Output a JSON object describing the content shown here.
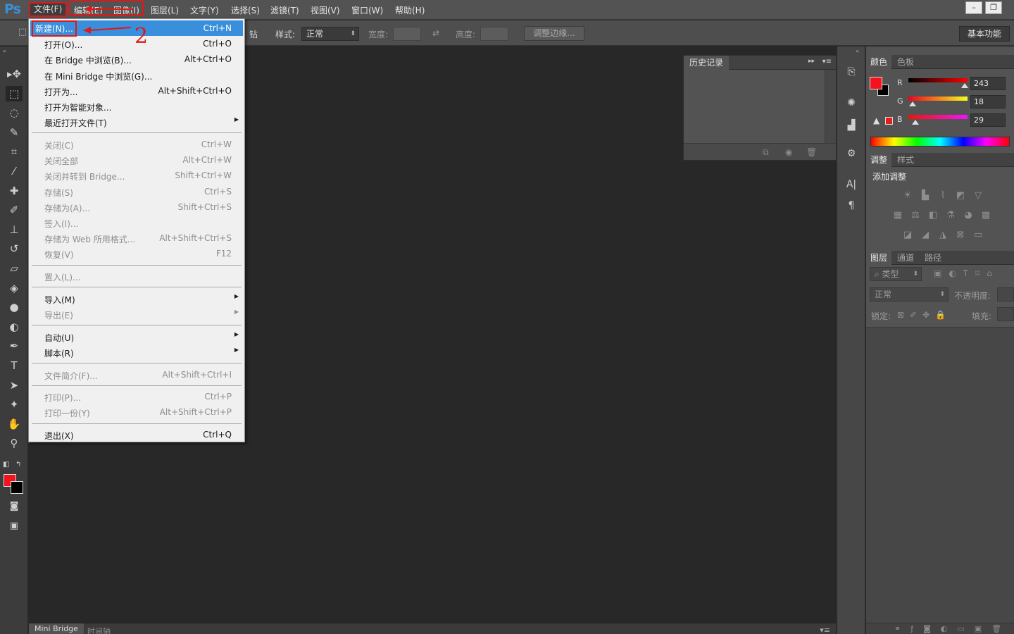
{
  "app": {
    "logo": "Ps"
  },
  "menubar": {
    "items": [
      "文件(F)",
      "编辑(E)",
      "图像(I)",
      "图层(L)",
      "文字(Y)",
      "选择(S)",
      "滤镜(T)",
      "视图(V)",
      "窗口(W)",
      "帮助(H)"
    ],
    "window_buttons": [
      "–",
      "❐"
    ]
  },
  "options_bar": {
    "clipped_label": "钻",
    "style_label": "样式:",
    "style_value": "正常",
    "width_label": "宽度:",
    "swap_icon": "⇄",
    "height_label": "高度:",
    "refine_edge": "调整边缘...",
    "workspace": "基本功能"
  },
  "annotation": {
    "step_number": "2"
  },
  "file_menu": {
    "items": [
      {
        "label": "新建(N)...",
        "shortcut": "Ctrl+N",
        "state": "highlighted"
      },
      {
        "label": "打开(O)...",
        "shortcut": "Ctrl+O"
      },
      {
        "label": "在 Bridge 中浏览(B)...",
        "shortcut": "Alt+Ctrl+O"
      },
      {
        "label": "在 Mini Bridge 中浏览(G)...",
        "shortcut": ""
      },
      {
        "label": "打开为...",
        "shortcut": "Alt+Shift+Ctrl+O"
      },
      {
        "label": "打开为智能对象...",
        "shortcut": ""
      },
      {
        "label": "最近打开文件(T)",
        "shortcut": "",
        "submenu": true
      },
      {
        "label": "关闭(C)",
        "shortcut": "Ctrl+W",
        "state": "disabled"
      },
      {
        "label": "关闭全部",
        "shortcut": "Alt+Ctrl+W",
        "state": "disabled"
      },
      {
        "label": "关闭并转到 Bridge...",
        "shortcut": "Shift+Ctrl+W",
        "state": "disabled"
      },
      {
        "label": "存储(S)",
        "shortcut": "Ctrl+S",
        "state": "disabled"
      },
      {
        "label": "存储为(A)...",
        "shortcut": "Shift+Ctrl+S",
        "state": "disabled"
      },
      {
        "label": "签入(I)...",
        "shortcut": "",
        "state": "disabled"
      },
      {
        "label": "存储为 Web 所用格式...",
        "shortcut": "Alt+Shift+Ctrl+S",
        "state": "disabled"
      },
      {
        "label": "恢复(V)",
        "shortcut": "F12",
        "state": "disabled"
      },
      {
        "label": "置入(L)...",
        "shortcut": "",
        "state": "disabled"
      },
      {
        "label": "导入(M)",
        "shortcut": "",
        "submenu": true
      },
      {
        "label": "导出(E)",
        "shortcut": "",
        "submenu": true,
        "state": "disabled"
      },
      {
        "label": "自动(U)",
        "shortcut": "",
        "submenu": true
      },
      {
        "label": "脚本(R)",
        "shortcut": "",
        "submenu": true
      },
      {
        "label": "文件简介(F)...",
        "shortcut": "Alt+Shift+Ctrl+I",
        "state": "disabled"
      },
      {
        "label": "打印(P)...",
        "shortcut": "Ctrl+P",
        "state": "disabled"
      },
      {
        "label": "打印一份(Y)",
        "shortcut": "Alt+Shift+Ctrl+P",
        "state": "disabled"
      },
      {
        "label": "退出(X)",
        "shortcut": "Ctrl+Q"
      }
    ],
    "submenu_glyph": "▶"
  },
  "toolbar": {
    "tools": [
      {
        "name": "move-tool",
        "glyph": "▸✥"
      },
      {
        "name": "marquee-tool",
        "glyph": "⬚",
        "selected": true
      },
      {
        "name": "lasso-tool",
        "glyph": "◌"
      },
      {
        "name": "quick-selection-tool",
        "glyph": "✎"
      },
      {
        "name": "crop-tool",
        "glyph": "⌗"
      },
      {
        "name": "eyedropper-tool",
        "glyph": "⁄"
      },
      {
        "name": "healing-brush-tool",
        "glyph": "✚"
      },
      {
        "name": "brush-tool",
        "glyph": "✐"
      },
      {
        "name": "clone-stamp-tool",
        "glyph": "⊥"
      },
      {
        "name": "history-brush-tool",
        "glyph": "↺"
      },
      {
        "name": "eraser-tool",
        "glyph": "▱"
      },
      {
        "name": "paint-bucket-tool",
        "glyph": "◈"
      },
      {
        "name": "blur-tool",
        "glyph": "●"
      },
      {
        "name": "dodge-tool",
        "glyph": "◐"
      },
      {
        "name": "pen-tool",
        "glyph": "✒"
      },
      {
        "name": "type-tool",
        "glyph": "T"
      },
      {
        "name": "path-selection-tool",
        "glyph": "➤"
      },
      {
        "name": "custom-shape-tool",
        "glyph": "✦"
      },
      {
        "name": "hand-tool",
        "glyph": "✋"
      },
      {
        "name": "zoom-tool",
        "glyph": "⚲"
      }
    ],
    "quick_mask_glyph": "◙",
    "screen_mode_glyph": "▣",
    "foreground_color": "#f3121d",
    "background_color": "#000000"
  },
  "history_panel": {
    "tab": "历史记录",
    "menu_icon": "▸▸",
    "footer_icons": [
      "⧉",
      "◉",
      "🗑"
    ]
  },
  "dock_icons": [
    {
      "name": "history-panel-icon",
      "glyph": "⎘"
    },
    {
      "name": "brush-panel-icon",
      "glyph": "✺"
    },
    {
      "name": "histogram-icon",
      "glyph": "▟"
    },
    {
      "name": "properties-icon",
      "glyph": "⚙"
    },
    {
      "name": "character-icon",
      "glyph": "A|"
    },
    {
      "name": "paragraph-icon",
      "glyph": "¶"
    }
  ],
  "color_panel": {
    "tabs": [
      "颜色",
      "色板"
    ],
    "channels": [
      {
        "label": "R",
        "value": "243"
      },
      {
        "label": "G",
        "value": "18"
      },
      {
        "label": "B",
        "value": "29"
      }
    ],
    "r_fraction": 0.953,
    "g_fraction": 0.071,
    "b_fraction": 0.114
  },
  "adjustments_panel": {
    "tabs": [
      "调整",
      "样式"
    ],
    "title": "添加调整",
    "icons_row1": [
      "☀",
      "▙",
      "⌇",
      "◩",
      "▽"
    ],
    "icons_row2": [
      "▦",
      "⚖",
      "◧",
      "⚗",
      "◕",
      "▩"
    ],
    "icons_row3": [
      "◪",
      "◢",
      "◮",
      "⊠",
      "▭"
    ]
  },
  "layers_panel": {
    "tabs": [
      "图层",
      "通道",
      "路径"
    ],
    "filter_label": "⌕ 类型",
    "blend_mode": "正常",
    "opacity_label": "不透明度:",
    "lock_label": "锁定:",
    "fill_label": "填充:"
  },
  "bottom_tabs": [
    "Mini Bridge",
    "时间轴"
  ]
}
